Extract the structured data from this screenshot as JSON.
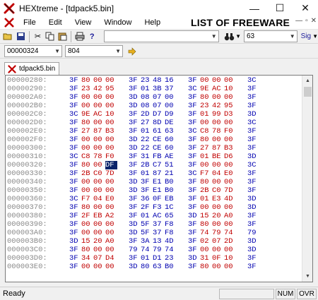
{
  "window": {
    "title": "HEXtreme - [tdpack5.bin]"
  },
  "menu": {
    "items": [
      "File",
      "Edit",
      "View",
      "Window",
      "Help"
    ]
  },
  "overlay_text": "LIST OF FREEWARE",
  "toolbar1": {
    "value_combo": "63",
    "sig_label": "Sig"
  },
  "toolbar2": {
    "offset": "00000324",
    "length": "804"
  },
  "tab": {
    "label": "tdpack5.bin"
  },
  "hex": {
    "rows": [
      {
        "addr": "00000280:",
        "bytes": [
          "3F",
          "80",
          "00",
          "00",
          "3F",
          "23",
          "48",
          "16",
          "3F",
          "00",
          "00",
          "00",
          "3C"
        ]
      },
      {
        "addr": "00000290:",
        "bytes": [
          "3F",
          "23",
          "42",
          "95",
          "3F",
          "01",
          "3B",
          "37",
          "3C",
          "9E",
          "AC",
          "10",
          "3F"
        ]
      },
      {
        "addr": "000002A0:",
        "bytes": [
          "3F",
          "00",
          "00",
          "00",
          "3D",
          "08",
          "07",
          "00",
          "3F",
          "80",
          "00",
          "00",
          "3F"
        ]
      },
      {
        "addr": "000002B0:",
        "bytes": [
          "3F",
          "00",
          "00",
          "00",
          "3D",
          "08",
          "07",
          "00",
          "3F",
          "23",
          "42",
          "95",
          "3F"
        ]
      },
      {
        "addr": "000002C0:",
        "bytes": [
          "3C",
          "9E",
          "AC",
          "10",
          "3F",
          "2D",
          "D7",
          "D9",
          "3F",
          "01",
          "99",
          "D3",
          "3D"
        ]
      },
      {
        "addr": "000002D0:",
        "bytes": [
          "3F",
          "80",
          "00",
          "00",
          "3F",
          "27",
          "8D",
          "DE",
          "3F",
          "00",
          "00",
          "00",
          "3C"
        ]
      },
      {
        "addr": "000002E0:",
        "bytes": [
          "3F",
          "27",
          "87",
          "B3",
          "3F",
          "01",
          "61",
          "63",
          "3C",
          "C8",
          "78",
          "F0",
          "3F"
        ]
      },
      {
        "addr": "000002F0:",
        "bytes": [
          "3F",
          "00",
          "00",
          "00",
          "3D",
          "22",
          "CE",
          "60",
          "3F",
          "80",
          "00",
          "00",
          "3F"
        ]
      },
      {
        "addr": "00000300:",
        "bytes": [
          "3F",
          "00",
          "00",
          "00",
          "3D",
          "22",
          "CE",
          "60",
          "3F",
          "27",
          "87",
          "B3",
          "3F"
        ]
      },
      {
        "addr": "00000310:",
        "bytes": [
          "3C",
          "C8",
          "78",
          "F0",
          "3F",
          "31",
          "FB",
          "AE",
          "3F",
          "01",
          "BE",
          "D6",
          "3D"
        ]
      },
      {
        "addr": "00000320:",
        "bytes": [
          "3F",
          "80",
          "00",
          "DF",
          "3F",
          "2B",
          "C7",
          "51",
          "3F",
          "00",
          "00",
          "00",
          "3C"
        ]
      },
      {
        "addr": "00000330:",
        "bytes": [
          "3F",
          "2B",
          "C0",
          "7D",
          "3F",
          "01",
          "87",
          "21",
          "3C",
          "F7",
          "04",
          "E0",
          "3F"
        ]
      },
      {
        "addr": "00000340:",
        "bytes": [
          "3F",
          "00",
          "00",
          "00",
          "3D",
          "3F",
          "E1",
          "B0",
          "3F",
          "80",
          "00",
          "00",
          "3F"
        ]
      },
      {
        "addr": "00000350:",
        "bytes": [
          "3F",
          "00",
          "00",
          "00",
          "3D",
          "3F",
          "E1",
          "B0",
          "3F",
          "2B",
          "C0",
          "7D",
          "3F"
        ]
      },
      {
        "addr": "00000360:",
        "bytes": [
          "3C",
          "F7",
          "04",
          "E0",
          "3F",
          "36",
          "0F",
          "EB",
          "3F",
          "01",
          "E3",
          "4D",
          "3D"
        ]
      },
      {
        "addr": "00000370:",
        "bytes": [
          "3F",
          "80",
          "00",
          "00",
          "3F",
          "2F",
          "F3",
          "1C",
          "3F",
          "00",
          "00",
          "00",
          "3D"
        ]
      },
      {
        "addr": "00000380:",
        "bytes": [
          "3F",
          "2F",
          "EB",
          "A2",
          "3F",
          "01",
          "AC",
          "65",
          "3D",
          "15",
          "20",
          "A0",
          "3F"
        ]
      },
      {
        "addr": "00000390:",
        "bytes": [
          "3F",
          "00",
          "00",
          "00",
          "3D",
          "5F",
          "37",
          "F8",
          "3F",
          "80",
          "00",
          "00",
          "3F"
        ]
      },
      {
        "addr": "000003A0:",
        "bytes": [
          "3F",
          "00",
          "00",
          "00",
          "3D",
          "5F",
          "37",
          "F8",
          "3F",
          "74",
          "79",
          "74",
          "79"
        ]
      },
      {
        "addr": "000003B0:",
        "bytes": [
          "3D",
          "15",
          "20",
          "A0",
          "3F",
          "3A",
          "13",
          "4D",
          "3F",
          "02",
          "07",
          "2D",
          "3D"
        ]
      },
      {
        "addr": "000003C0:",
        "bytes": [
          "3F",
          "80",
          "00",
          "00",
          "79",
          "74",
          "79",
          "74",
          "3F",
          "00",
          "00",
          "00",
          "3D"
        ]
      },
      {
        "addr": "000003D0:",
        "bytes": [
          "3F",
          "34",
          "07",
          "D4",
          "3F",
          "01",
          "D1",
          "23",
          "3D",
          "31",
          "0F",
          "10",
          "3F"
        ]
      },
      {
        "addr": "000003E0:",
        "bytes": [
          "3F",
          "00",
          "00",
          "00",
          "3D",
          "80",
          "63",
          "B0",
          "3F",
          "80",
          "00",
          "00",
          "3F"
        ]
      }
    ],
    "selected": {
      "row": 10,
      "col": 3
    }
  },
  "status": {
    "text": "Ready",
    "num": "NUM",
    "ovr": "OVR"
  },
  "colors": {
    "hex_blue": "#0000b0",
    "hex_red": "#c00000",
    "selection": "#0a246a",
    "address_gray": "#8a8a8a"
  }
}
